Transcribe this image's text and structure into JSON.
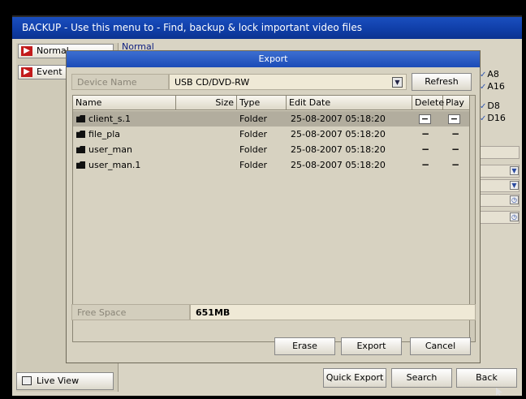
{
  "window": {
    "title": "BACKUP - Use this menu to - Find, backup & lock important video files"
  },
  "sidebar": {
    "tabs": [
      {
        "label": "Normal"
      },
      {
        "label": "Event"
      }
    ],
    "live_view": "Live View"
  },
  "background": {
    "section_label": "Normal",
    "channel_checks": [
      "A8",
      "A16",
      "D8",
      "D16"
    ],
    "buttons": {
      "quick_export": "Quick Export",
      "search": "Search",
      "back": "Back"
    }
  },
  "dialog": {
    "title": "Export",
    "device_name_label": "Device Name",
    "device_name_value": "USB CD/DVD-RW",
    "refresh_label": "Refresh",
    "columns": [
      "Name",
      "Size",
      "Type",
      "Edit Date",
      "Delete",
      "Play"
    ],
    "rows": [
      {
        "name": "client_s.1",
        "size": "",
        "type": "Folder",
        "edit_date": "25-08-2007 05:18:20",
        "delete": "−",
        "play": "−",
        "selected": true
      },
      {
        "name": "file_pla",
        "size": "",
        "type": "Folder",
        "edit_date": "25-08-2007 05:18:20",
        "delete": "−",
        "play": "−",
        "selected": false
      },
      {
        "name": "user_man",
        "size": "",
        "type": "Folder",
        "edit_date": "25-08-2007 05:18:20",
        "delete": "−",
        "play": "−",
        "selected": false
      },
      {
        "name": "user_man.1",
        "size": "",
        "type": "Folder",
        "edit_date": "25-08-2007 05:18:20",
        "delete": "−",
        "play": "−",
        "selected": false
      }
    ],
    "free_space_label": "Free Space",
    "free_space_value": "651MB",
    "buttons": {
      "erase": "Erase",
      "export": "Export",
      "cancel": "Cancel"
    }
  },
  "colors": {
    "title_bar": "#1a4fbf",
    "panel": "#d7d2c1",
    "selected_row": "#b2ad9e",
    "tab_arrow": "#c21b1b"
  },
  "icons": {
    "tab_arrow": "arrow-right-icon",
    "live_view": "live-view-icon",
    "folder": "folder-icon",
    "dropdown": "chevron-down-icon",
    "checkbox": "checkmark-icon"
  }
}
